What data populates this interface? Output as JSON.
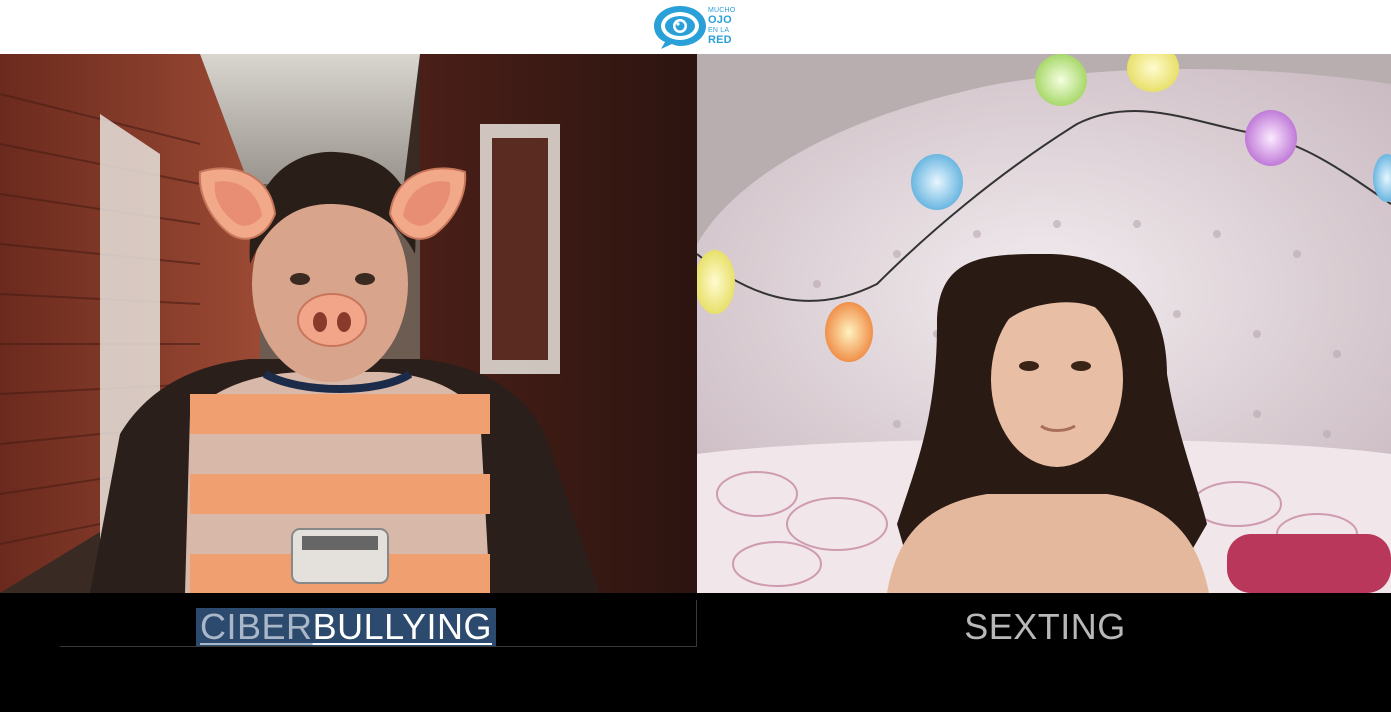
{
  "header": {
    "logo": {
      "line1": "MUCHO",
      "line2": "OJO",
      "line3": "EN LA",
      "line4": "RED",
      "color": "#2aa0d8"
    }
  },
  "tabs": {
    "ciber": {
      "part1": "CIBER",
      "part2": "BULLYING",
      "active": true,
      "bg": "#2c4a6e"
    },
    "sexting": {
      "label": "SEXTING",
      "active": false
    }
  },
  "icons": [
    "eye-speech-bubble-icon"
  ]
}
